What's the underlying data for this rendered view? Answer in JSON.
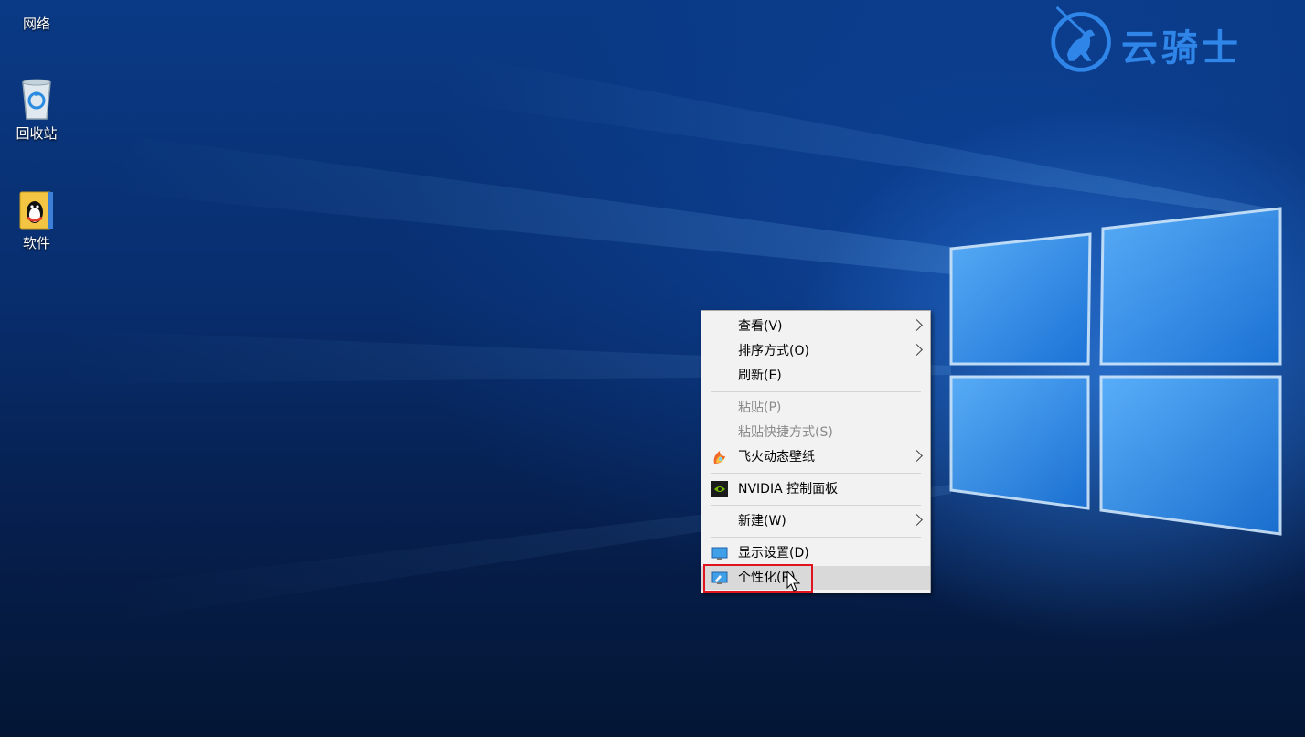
{
  "desktop": {
    "icons": [
      {
        "label": "网络",
        "icon": "network-icon"
      },
      {
        "label": "回收站",
        "icon": "recycle-bin-icon"
      },
      {
        "label": "软件",
        "icon": "qq-folder-icon"
      }
    ]
  },
  "watermark": {
    "text": "云骑士",
    "logo": "knight-logo-icon",
    "color": "#2f86e8"
  },
  "context_menu": {
    "items": [
      {
        "label": "查看(V)",
        "submenu": true,
        "disabled": false
      },
      {
        "label": "排序方式(O)",
        "submenu": true,
        "disabled": false
      },
      {
        "label": "刷新(E)",
        "submenu": false,
        "disabled": false
      },
      {
        "label": "粘贴(P)",
        "submenu": false,
        "disabled": true
      },
      {
        "label": "粘贴快捷方式(S)",
        "submenu": false,
        "disabled": true
      },
      {
        "label": "飞火动态壁纸",
        "submenu": true,
        "disabled": false,
        "icon": "feihuo-wallpaper-icon"
      },
      {
        "label": "NVIDIA 控制面板",
        "submenu": false,
        "disabled": false,
        "icon": "nvidia-icon"
      },
      {
        "label": "新建(W)",
        "submenu": true,
        "disabled": false
      },
      {
        "label": "显示设置(D)",
        "submenu": false,
        "disabled": false,
        "icon": "display-settings-icon"
      },
      {
        "label": "个性化(R)",
        "submenu": false,
        "disabled": false,
        "icon": "personalize-icon",
        "hovered": true
      }
    ]
  },
  "colors": {
    "highlight_border": "#e0141e",
    "menu_background": "#f2f2f2",
    "menu_hover": "#d9d9d9",
    "disabled_text": "#8a8a8a"
  }
}
